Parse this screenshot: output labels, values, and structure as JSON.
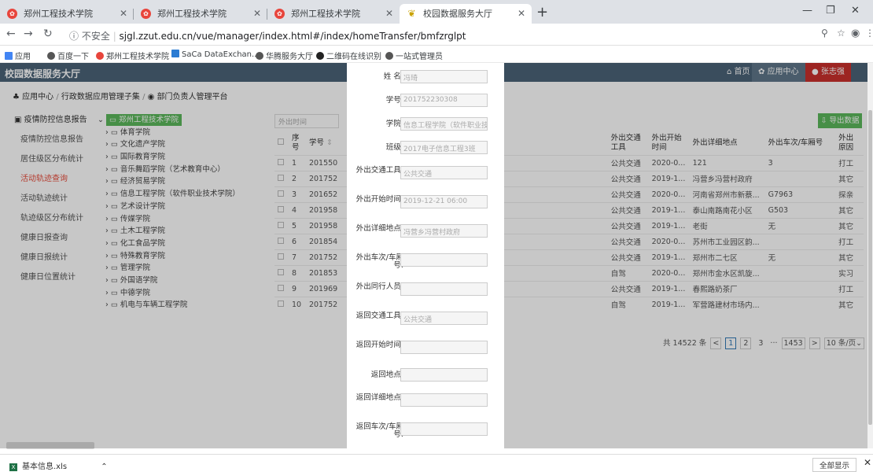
{
  "browser": {
    "tabs": [
      {
        "title": "郑州工程技术学院",
        "active": false
      },
      {
        "title": "郑州工程技术学院",
        "active": false
      },
      {
        "title": "郑州工程技术学院",
        "active": false
      },
      {
        "title": "校园数据服务大厅",
        "active": true
      }
    ],
    "insecure_label": "不安全",
    "url": "sjgl.zzut.edu.cn/vue/manager/index.html#/index/homeTransfer/bmfzrglpt",
    "bookmarks": [
      "应用",
      "百度一下",
      "郑州工程技术学院",
      "SaCa DataExchan...",
      "华腾服务大厅",
      "二维码在线识别",
      "一站式管理员"
    ]
  },
  "app": {
    "title": "校园数据服务大厅",
    "nav": {
      "home": "首页",
      "apps": "应用中心",
      "user": "张志强"
    },
    "breadcrumb": {
      "part1": "应用中心",
      "part2": "行政数据应用管理子集",
      "part3": "部门负责人管理平台"
    },
    "sidebar": {
      "section": "疫情防控信息报告",
      "items": [
        "疫情防控信息报告",
        "居住级区分布统计",
        "活动轨迹查询",
        "活动轨迹统计",
        "轨迹级区分布统计",
        "健康日报查询",
        "健康日报统计",
        "健康日位置统计"
      ]
    },
    "tree": {
      "root": "郑州工程技术学院",
      "nodes": [
        "体育学院",
        "文化遗产学院",
        "国际教育学院",
        "音乐舞蹈学院（艺术教育中心）",
        "经济贸易学院",
        "信息工程学院（软件职业技术学院）",
        "艺术设计学院",
        "传媒学院",
        "土木工程学院",
        "化工食品学院",
        "特殊教育学院",
        "管理学院",
        "外国语学院",
        "中德学院",
        "机电与车辆工程学院"
      ]
    },
    "filter_placeholder": "外出时间",
    "export_label": "导出数据",
    "table": {
      "headers": {
        "index": "序号",
        "id": "学号",
        "transport": "外出交通工具",
        "start": "外出开始时间",
        "detail": "外出详细地点",
        "vehicle": "外出车次/车厢号",
        "reason": "外出原因"
      },
      "rows": [
        {
          "n": "1",
          "id": "201550",
          "transport": "公共交通",
          "start": "2020-0...",
          "detail": "121",
          "vehicle": "3",
          "reason": "打工"
        },
        {
          "n": "2",
          "id": "201752",
          "transport": "公共交通",
          "start": "2019-1...",
          "detail": "冯营乡冯营村政府",
          "vehicle": "",
          "reason": "其它"
        },
        {
          "n": "3",
          "id": "201652",
          "transport": "公共交通",
          "start": "2020-0...",
          "detail": "河南省郑州市新蔡...",
          "vehicle": "G7963",
          "reason": "探亲"
        },
        {
          "n": "4",
          "id": "201958",
          "transport": "公共交通",
          "start": "2019-1...",
          "detail": "泰山南路南花小区",
          "vehicle": "G503",
          "reason": "其它"
        },
        {
          "n": "5",
          "id": "201958",
          "transport": "公共交通",
          "start": "2019-1...",
          "detail": "老街",
          "vehicle": "无",
          "reason": "其它"
        },
        {
          "n": "6",
          "id": "201854",
          "transport": "公共交通",
          "start": "2020-0...",
          "detail": "苏州市工业园区韵...",
          "vehicle": "",
          "reason": "打工"
        },
        {
          "n": "7",
          "id": "201752",
          "transport": "公共交通",
          "start": "2019-1...",
          "detail": "郑州市二七区",
          "vehicle": "无",
          "reason": "其它"
        },
        {
          "n": "8",
          "id": "201853",
          "transport": "自驾",
          "start": "2020-0...",
          "detail": "郑州市金水区凯旋...",
          "vehicle": "",
          "reason": "实习"
        },
        {
          "n": "9",
          "id": "201969",
          "transport": "公共交通",
          "start": "2019-1...",
          "detail": "春熙路奶茶厂",
          "vehicle": "",
          "reason": "打工"
        },
        {
          "n": "10",
          "id": "201752",
          "transport": "自驾",
          "start": "2019-1...",
          "detail": "军营路建材市场内...",
          "vehicle": "",
          "reason": "其它"
        }
      ]
    },
    "pager": {
      "total": "共 14522 条",
      "pages": [
        "1",
        "2",
        "3",
        "···",
        "1453"
      ],
      "page_size": "10 条/页"
    }
  },
  "modal": {
    "fields": [
      {
        "label": "姓 名:",
        "value": "冯琦"
      },
      {
        "label": "学号:",
        "value": "201752230308"
      },
      {
        "label": "学院:",
        "value": "信息工程学院（软件职业技术"
      },
      {
        "label": "班级:",
        "value": "2017电子信息工程3班"
      },
      {
        "label": "外出交通工具:",
        "value": "公共交通"
      },
      {
        "label": "外出开始时间:",
        "value": "2019-12-21 06:00"
      },
      {
        "label": "外出详细地点:",
        "value": "冯营乡冯营村政府"
      },
      {
        "label": "外出车次/车厢号:",
        "value": ""
      },
      {
        "label": "外出同行人员:",
        "value": ""
      },
      {
        "label": "返回交通工具:",
        "value": "公共交通"
      },
      {
        "label": "返回开始时间:",
        "value": ""
      },
      {
        "label": "返回地点:",
        "value": ""
      },
      {
        "label": "返回详细地点:",
        "value": ""
      },
      {
        "label": "返回车次/车厢号:",
        "value": ""
      }
    ]
  },
  "download": {
    "file": "基本信息.xls",
    "show_all": "全部显示"
  }
}
